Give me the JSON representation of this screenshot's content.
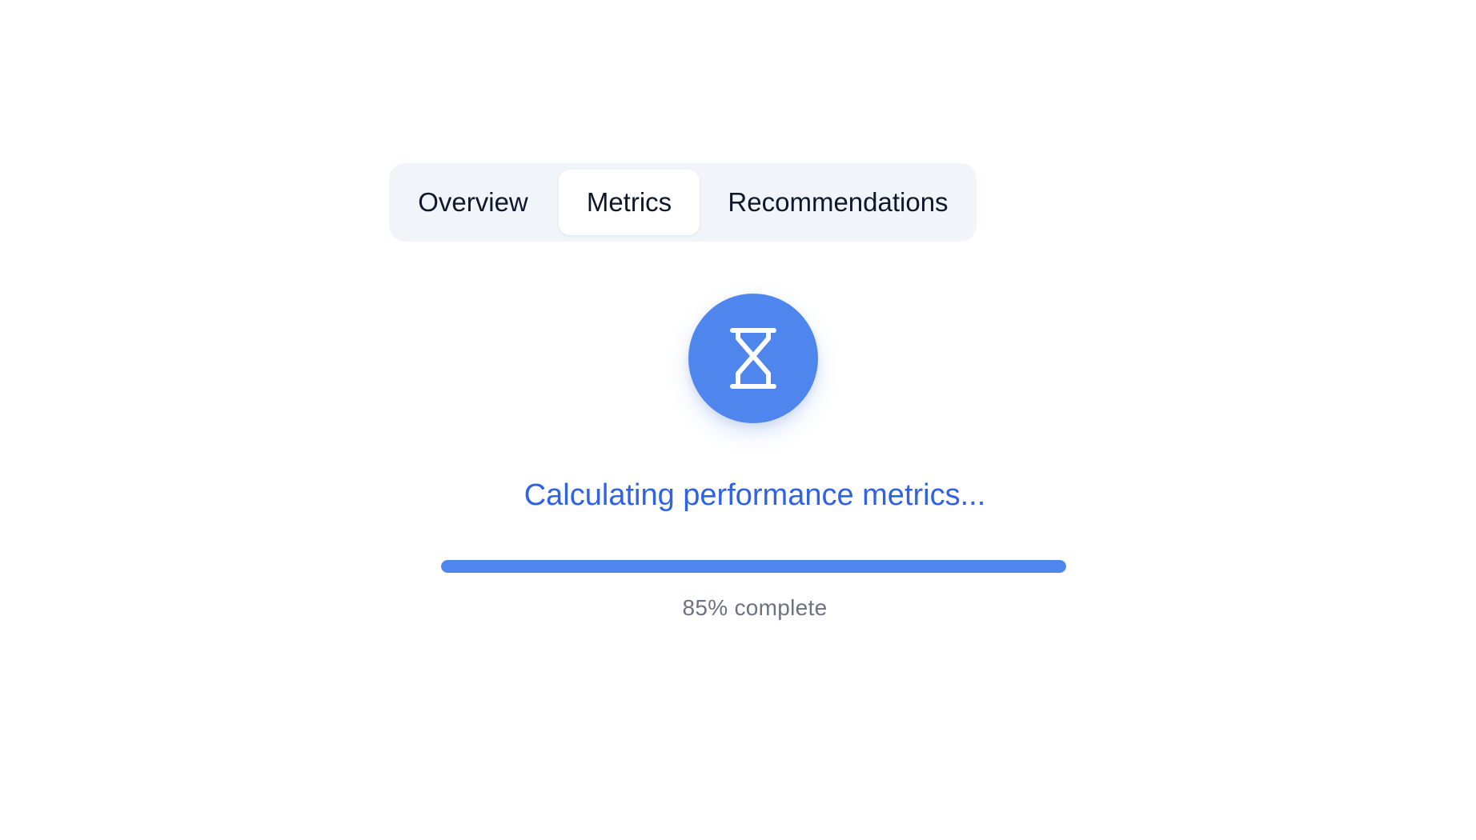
{
  "tabs": {
    "items": [
      {
        "label": "Overview"
      },
      {
        "label": "Metrics"
      },
      {
        "label": "Recommendations"
      }
    ],
    "active": "Metrics"
  },
  "loader": {
    "icon": "hourglass-icon",
    "status_text": "Calculating performance metrics...",
    "progress_percent": 85,
    "progress_caption": "85% complete"
  },
  "colors": {
    "accent": "#4f86ee",
    "status_text": "#2f62e6",
    "tab_bar_bg": "#f1f5f9",
    "caption": "#6b7280"
  }
}
